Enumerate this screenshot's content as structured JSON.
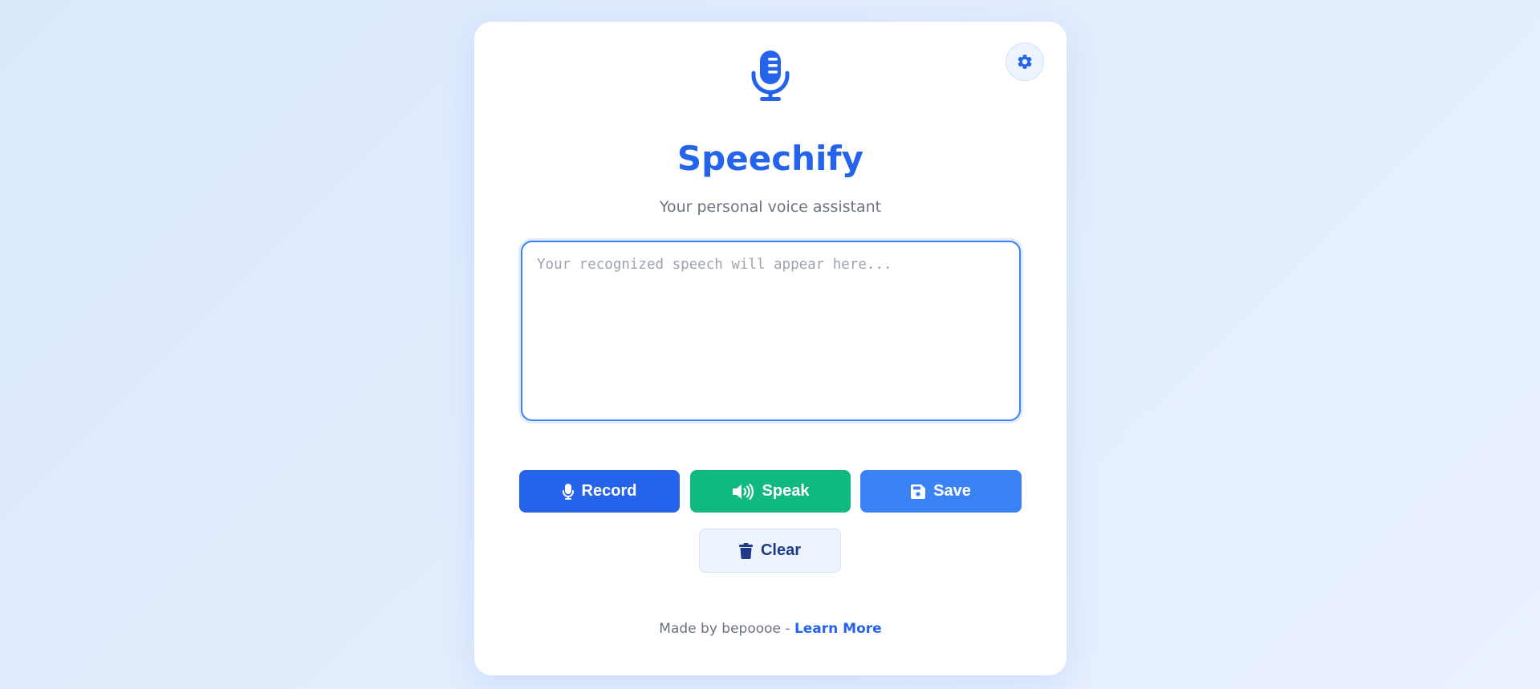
{
  "app": {
    "title": "Speechify",
    "subtitle": "Your personal voice assistant"
  },
  "speech": {
    "value": "",
    "placeholder": "Your recognized speech will appear here..."
  },
  "buttons": {
    "record": {
      "label": "Record",
      "icon": "microphone-icon",
      "color": "#2563eb"
    },
    "speak": {
      "label": "Speak",
      "icon": "speaker-icon",
      "color": "#10b981"
    },
    "save": {
      "label": "Save",
      "icon": "floppy-disk-icon",
      "color": "#3b82f6"
    },
    "clear": {
      "label": "Clear",
      "icon": "trash-icon",
      "color": "#eef4fe"
    }
  },
  "settings": {
    "icon": "gear-icon"
  },
  "footer": {
    "prefix": "Made by bepoooe - ",
    "link_label": "Learn More"
  },
  "colors": {
    "accent": "#2563eb",
    "success": "#10b981",
    "background": "#dce9fd"
  }
}
